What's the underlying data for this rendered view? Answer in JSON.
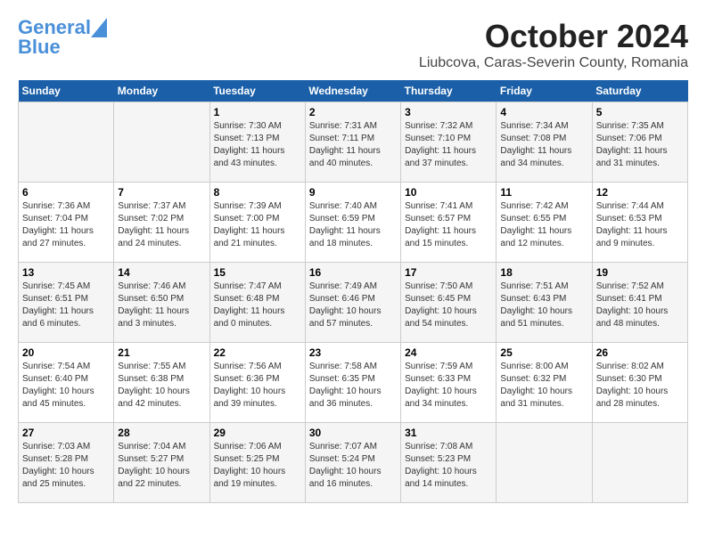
{
  "logo": {
    "line1": "General",
    "line2": "Blue"
  },
  "title": "October 2024",
  "location": "Liubcova, Caras-Severin County, Romania",
  "days_of_week": [
    "Sunday",
    "Monday",
    "Tuesday",
    "Wednesday",
    "Thursday",
    "Friday",
    "Saturday"
  ],
  "weeks": [
    [
      {
        "day": "",
        "info": ""
      },
      {
        "day": "",
        "info": ""
      },
      {
        "day": "1",
        "info": "Sunrise: 7:30 AM\nSunset: 7:13 PM\nDaylight: 11 hours and 43 minutes."
      },
      {
        "day": "2",
        "info": "Sunrise: 7:31 AM\nSunset: 7:11 PM\nDaylight: 11 hours and 40 minutes."
      },
      {
        "day": "3",
        "info": "Sunrise: 7:32 AM\nSunset: 7:10 PM\nDaylight: 11 hours and 37 minutes."
      },
      {
        "day": "4",
        "info": "Sunrise: 7:34 AM\nSunset: 7:08 PM\nDaylight: 11 hours and 34 minutes."
      },
      {
        "day": "5",
        "info": "Sunrise: 7:35 AM\nSunset: 7:06 PM\nDaylight: 11 hours and 31 minutes."
      }
    ],
    [
      {
        "day": "6",
        "info": "Sunrise: 7:36 AM\nSunset: 7:04 PM\nDaylight: 11 hours and 27 minutes."
      },
      {
        "day": "7",
        "info": "Sunrise: 7:37 AM\nSunset: 7:02 PM\nDaylight: 11 hours and 24 minutes."
      },
      {
        "day": "8",
        "info": "Sunrise: 7:39 AM\nSunset: 7:00 PM\nDaylight: 11 hours and 21 minutes."
      },
      {
        "day": "9",
        "info": "Sunrise: 7:40 AM\nSunset: 6:59 PM\nDaylight: 11 hours and 18 minutes."
      },
      {
        "day": "10",
        "info": "Sunrise: 7:41 AM\nSunset: 6:57 PM\nDaylight: 11 hours and 15 minutes."
      },
      {
        "day": "11",
        "info": "Sunrise: 7:42 AM\nSunset: 6:55 PM\nDaylight: 11 hours and 12 minutes."
      },
      {
        "day": "12",
        "info": "Sunrise: 7:44 AM\nSunset: 6:53 PM\nDaylight: 11 hours and 9 minutes."
      }
    ],
    [
      {
        "day": "13",
        "info": "Sunrise: 7:45 AM\nSunset: 6:51 PM\nDaylight: 11 hours and 6 minutes."
      },
      {
        "day": "14",
        "info": "Sunrise: 7:46 AM\nSunset: 6:50 PM\nDaylight: 11 hours and 3 minutes."
      },
      {
        "day": "15",
        "info": "Sunrise: 7:47 AM\nSunset: 6:48 PM\nDaylight: 11 hours and 0 minutes."
      },
      {
        "day": "16",
        "info": "Sunrise: 7:49 AM\nSunset: 6:46 PM\nDaylight: 10 hours and 57 minutes."
      },
      {
        "day": "17",
        "info": "Sunrise: 7:50 AM\nSunset: 6:45 PM\nDaylight: 10 hours and 54 minutes."
      },
      {
        "day": "18",
        "info": "Sunrise: 7:51 AM\nSunset: 6:43 PM\nDaylight: 10 hours and 51 minutes."
      },
      {
        "day": "19",
        "info": "Sunrise: 7:52 AM\nSunset: 6:41 PM\nDaylight: 10 hours and 48 minutes."
      }
    ],
    [
      {
        "day": "20",
        "info": "Sunrise: 7:54 AM\nSunset: 6:40 PM\nDaylight: 10 hours and 45 minutes."
      },
      {
        "day": "21",
        "info": "Sunrise: 7:55 AM\nSunset: 6:38 PM\nDaylight: 10 hours and 42 minutes."
      },
      {
        "day": "22",
        "info": "Sunrise: 7:56 AM\nSunset: 6:36 PM\nDaylight: 10 hours and 39 minutes."
      },
      {
        "day": "23",
        "info": "Sunrise: 7:58 AM\nSunset: 6:35 PM\nDaylight: 10 hours and 36 minutes."
      },
      {
        "day": "24",
        "info": "Sunrise: 7:59 AM\nSunset: 6:33 PM\nDaylight: 10 hours and 34 minutes."
      },
      {
        "day": "25",
        "info": "Sunrise: 8:00 AM\nSunset: 6:32 PM\nDaylight: 10 hours and 31 minutes."
      },
      {
        "day": "26",
        "info": "Sunrise: 8:02 AM\nSunset: 6:30 PM\nDaylight: 10 hours and 28 minutes."
      }
    ],
    [
      {
        "day": "27",
        "info": "Sunrise: 7:03 AM\nSunset: 5:28 PM\nDaylight: 10 hours and 25 minutes."
      },
      {
        "day": "28",
        "info": "Sunrise: 7:04 AM\nSunset: 5:27 PM\nDaylight: 10 hours and 22 minutes."
      },
      {
        "day": "29",
        "info": "Sunrise: 7:06 AM\nSunset: 5:25 PM\nDaylight: 10 hours and 19 minutes."
      },
      {
        "day": "30",
        "info": "Sunrise: 7:07 AM\nSunset: 5:24 PM\nDaylight: 10 hours and 16 minutes."
      },
      {
        "day": "31",
        "info": "Sunrise: 7:08 AM\nSunset: 5:23 PM\nDaylight: 10 hours and 14 minutes."
      },
      {
        "day": "",
        "info": ""
      },
      {
        "day": "",
        "info": ""
      }
    ]
  ]
}
